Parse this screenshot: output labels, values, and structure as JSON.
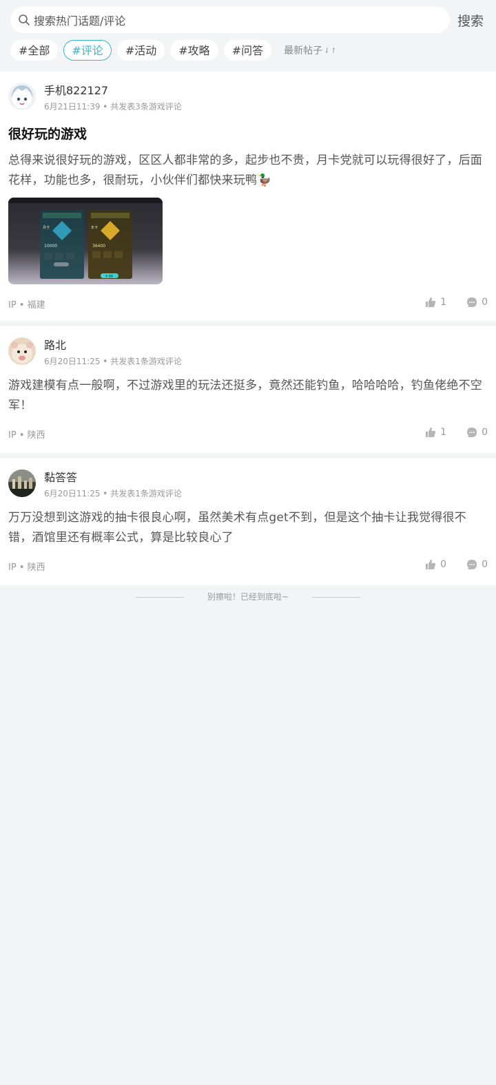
{
  "search": {
    "placeholder": "搜索热门话题/评论",
    "button": "搜索"
  },
  "tags": [
    {
      "label": "#全部",
      "active": false
    },
    {
      "label": "#评论",
      "active": true
    },
    {
      "label": "#活动",
      "active": false
    },
    {
      "label": "#攻略",
      "active": false
    },
    {
      "label": "#问答",
      "active": false
    }
  ],
  "sort": {
    "label": "最新帖子",
    "icon": "sort-arrows-icon"
  },
  "accent_color": "#35b6c8",
  "posts": [
    {
      "username": "手机822127",
      "meta": "6月21日11:39 • 共发表3条游戏评论",
      "title": "很好玩的游戏",
      "body": "总得来说很好玩的游戏，区区人都非常的多，起步也不贵，月卡党就可以玩得很好了，后面花样，功能也多，很耐玩，小伙伴们都快来玩鸭🦆",
      "image": {
        "left_card": {
          "title": "月卡",
          "value": "10000"
        },
        "right_card": {
          "title": "年卡",
          "value": "36400"
        },
        "button": "¥ 88"
      },
      "ip": "IP • 福建",
      "likes": "1",
      "comments": "0"
    },
    {
      "username": "路北",
      "meta": "6月20日11:25 • 共发表1条游戏评论",
      "title": "",
      "body": "游戏建模有点一般啊，不过游戏里的玩法还挺多，竟然还能钓鱼，哈哈哈哈，钓鱼佬绝不空军！",
      "ip": "IP • 陕西",
      "likes": "1",
      "comments": "0"
    },
    {
      "username": "黏答答",
      "meta": "6月20日11:25 • 共发表1条游戏评论",
      "title": "",
      "body": "万万没想到这游戏的抽卡很良心啊，虽然美术有点get不到，但是这个抽卡让我觉得很不错，酒馆里还有概率公式，算是比较良心了",
      "ip": "IP • 陕西",
      "likes": "0",
      "comments": "0"
    }
  ],
  "end_text": "别擦啦！已经到底啦~"
}
